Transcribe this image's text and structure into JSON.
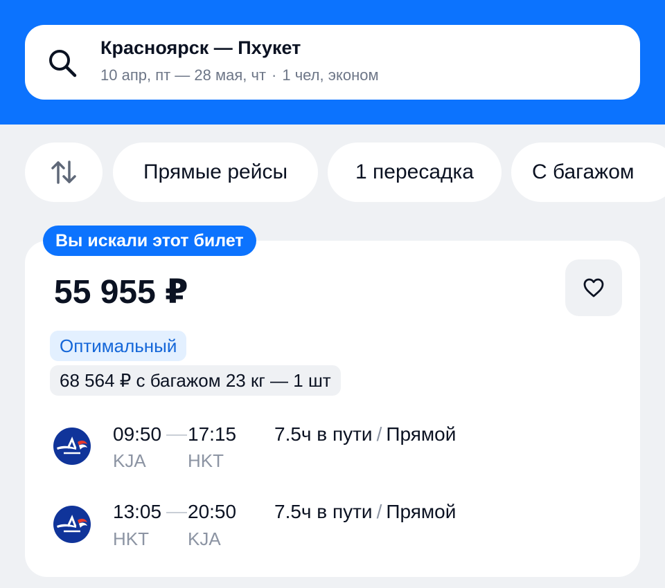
{
  "search": {
    "route": "Красноярск — Пхукет",
    "dates": "10 апр, пт — 28 мая, чт",
    "separator": "·",
    "passengers": "1 чел, эконом"
  },
  "filters": {
    "sort_icon": "sort-arrows-icon",
    "chips": [
      "Прямые рейсы",
      "1 пересадка",
      "С багажом"
    ]
  },
  "ticket": {
    "badge": "Вы искали этот билет",
    "price": "55 955 ₽",
    "tag": "Оптимальный",
    "baggage_price": "68 564 ₽ с багажом 23 кг — 1 шт",
    "favorite_icon": "heart-icon",
    "segments": [
      {
        "airline_logo": "aeroflot-logo",
        "depart_time": "09:50",
        "arrive_time": "17:15",
        "depart_code": "KJA",
        "arrive_code": "HKT",
        "duration": "7.5ч в пути",
        "slash": "/",
        "type": "Прямой"
      },
      {
        "airline_logo": "aeroflot-logo",
        "depart_time": "13:05",
        "arrive_time": "20:50",
        "depart_code": "HKT",
        "arrive_code": "KJA",
        "duration": "7.5ч в пути",
        "slash": "/",
        "type": "Прямой"
      }
    ]
  },
  "colors": {
    "brand_blue": "#0c73fe",
    "background": "#eff1f4",
    "tag_bg": "#e3f0ff",
    "tag_text": "#1466d8",
    "airline_navy": "#10349a"
  }
}
